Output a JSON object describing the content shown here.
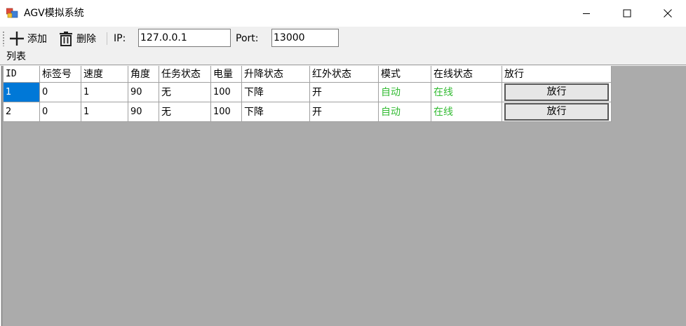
{
  "window": {
    "title": "AGV模拟系统"
  },
  "toolbar": {
    "add_label": "添加",
    "delete_label": "删除",
    "ip_label": "IP:",
    "ip_value": "127.0.0.1",
    "port_label": "Port:",
    "port_value": "13000"
  },
  "group": {
    "label": "列表"
  },
  "colors": {
    "selection": "#0078d7",
    "status_green": "#33bb33"
  },
  "grid": {
    "columns": [
      "ID",
      "标签号",
      "速度",
      "角度",
      "任务状态",
      "电量",
      "升降状态",
      "红外状态",
      "模式",
      "在线状态",
      "放行"
    ],
    "rows": [
      {
        "id": "1",
        "tag": "0",
        "speed": "1",
        "angle": "90",
        "task": "无",
        "battery": "100",
        "lift": "下降",
        "infrared": "开",
        "mode": "自动",
        "online": "在线",
        "action": "放行"
      },
      {
        "id": "2",
        "tag": "0",
        "speed": "1",
        "angle": "90",
        "task": "无",
        "battery": "100",
        "lift": "下降",
        "infrared": "开",
        "mode": "自动",
        "online": "在线",
        "action": "放行"
      }
    ],
    "selected_cell": "rows.0.id"
  }
}
